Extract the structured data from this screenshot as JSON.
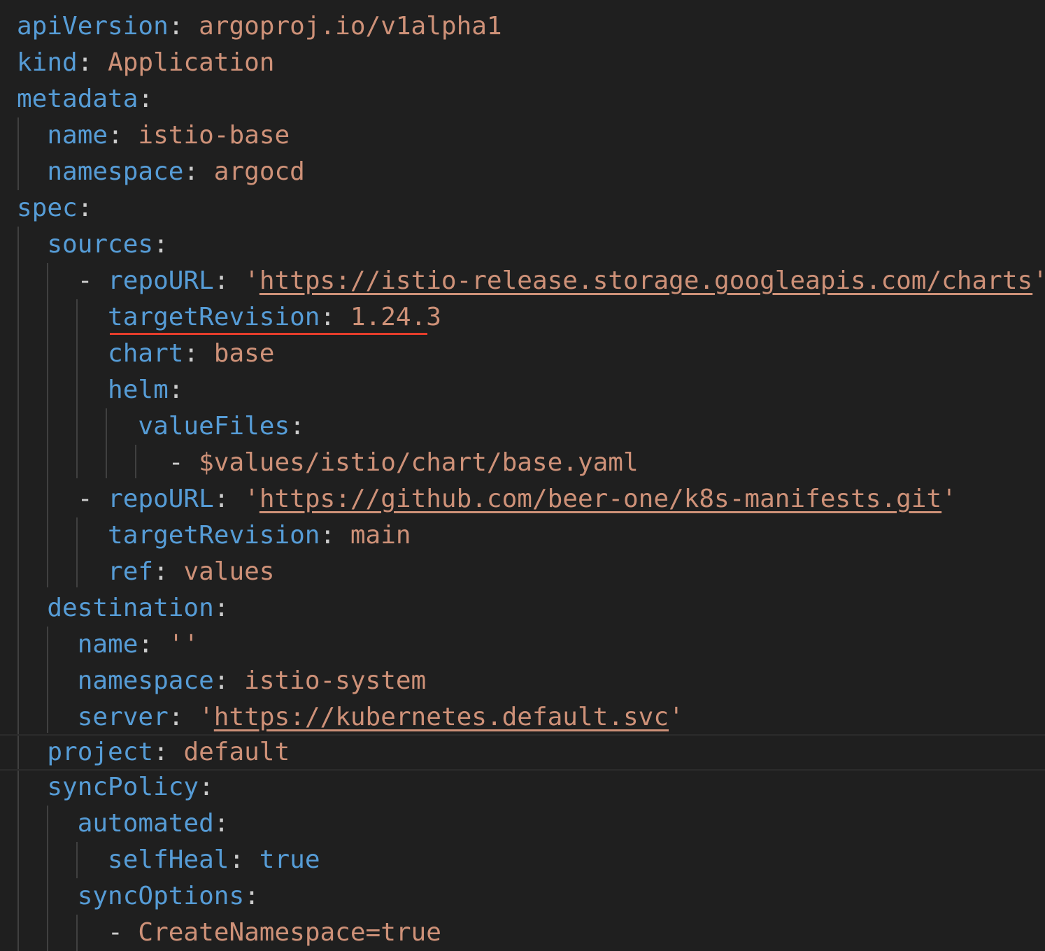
{
  "lines": {
    "l0": {
      "key": "apiVersion",
      "value": "argoproj.io/v1alpha1"
    },
    "l1": {
      "key": "kind",
      "value": "Application"
    },
    "l2": {
      "key": "metadata"
    },
    "l3": {
      "key": "name",
      "value": "istio-base"
    },
    "l4": {
      "key": "namespace",
      "value": "argocd"
    },
    "l5": {
      "key": "spec"
    },
    "l6": {
      "key": "sources"
    },
    "l7": {
      "key": "repoURL",
      "value": "https://istio-release.storage.googleapis.com/charts"
    },
    "l8": {
      "key": "targetRevision",
      "value": "1.24.3"
    },
    "l9": {
      "key": "chart",
      "value": "base"
    },
    "l10": {
      "key": "helm"
    },
    "l11": {
      "key": "valueFiles"
    },
    "l12": {
      "value": "$values/istio/chart/base.yaml"
    },
    "l13": {
      "key": "repoURL",
      "value": "https://github.com/beer-one/k8s-manifests.git"
    },
    "l14": {
      "key": "targetRevision",
      "value": "main"
    },
    "l15": {
      "key": "ref",
      "value": "values"
    },
    "l16": {
      "key": "destination"
    },
    "l17": {
      "key": "name",
      "value": "''"
    },
    "l18": {
      "key": "namespace",
      "value": "istio-system"
    },
    "l19": {
      "key": "server",
      "value": "https://kubernetes.default.svc"
    },
    "l20": {
      "key": "project",
      "value": "default"
    },
    "l21": {
      "key": "syncPolicy"
    },
    "l22": {
      "key": "automated"
    },
    "l23": {
      "key": "selfHeal",
      "value": "true"
    },
    "l24": {
      "key": "syncOptions"
    },
    "l25": {
      "value": "CreateNamespace=true"
    }
  },
  "colors": {
    "background": "#1f1f1f",
    "key": "#569cd6",
    "string": "#ce9178",
    "error_squiggle": "#e53d2b"
  }
}
